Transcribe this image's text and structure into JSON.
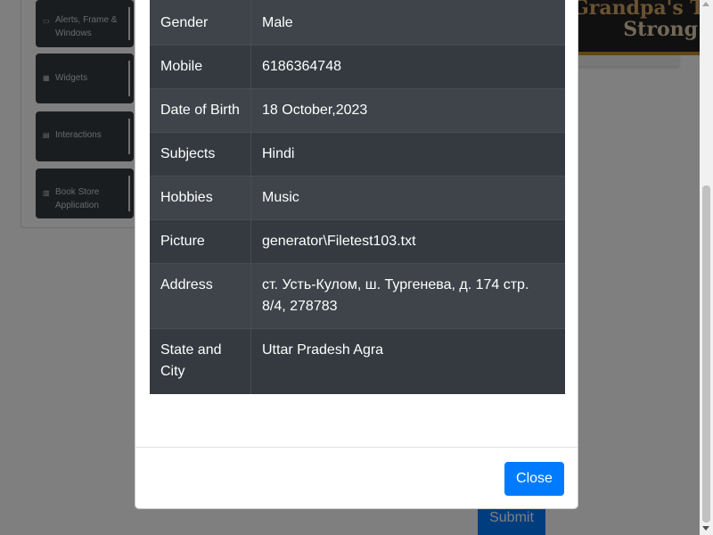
{
  "sidebar": {
    "items": [
      {
        "label": "Alerts, Frame & Windows",
        "icon": "window-icon"
      },
      {
        "label": "Widgets",
        "icon": "grid-icon"
      },
      {
        "label": "Interactions",
        "icon": "list-icon"
      },
      {
        "label": "Book Store Application",
        "icon": "bar-chart-icon"
      }
    ]
  },
  "banner": {
    "line1": "Grandpa's The",
    "line2": "Strong"
  },
  "form": {
    "submit_label": "Submit"
  },
  "modal": {
    "rows": [
      {
        "key": "Gender",
        "value": "Male"
      },
      {
        "key": "Mobile",
        "value": "6186364748"
      },
      {
        "key": "Date of Birth",
        "value": "18 October,2023"
      },
      {
        "key": "Subjects",
        "value": "Hindi"
      },
      {
        "key": "Hobbies",
        "value": "Music"
      },
      {
        "key": "Picture",
        "value": "generator\\Filetest103.txt"
      },
      {
        "key": "Address",
        "value": "ст. Усть-Кулом, ш. Тургенева, д. 174 стр. 8/4, 278783"
      },
      {
        "key": "State and City",
        "value": "Uttar Pradesh Agra"
      }
    ],
    "close_label": "Close"
  },
  "colors": {
    "primary": "#007bff",
    "table_dark": "#343a40",
    "table_stripe": "#3e444a"
  }
}
